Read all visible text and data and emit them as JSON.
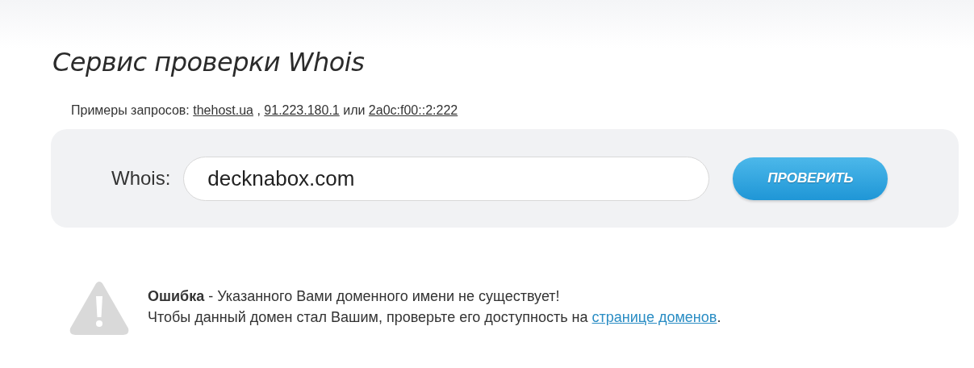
{
  "title": "Сервис проверки Whois",
  "examples": {
    "label": "Примеры запросов:",
    "links": [
      "thehost.ua",
      "91.223.180.1",
      "2a0c:f00::2:222"
    ],
    "separator": ",",
    "last_separator": "или"
  },
  "search": {
    "label": "Whois:",
    "value": "decknabox.com",
    "button": "ПРОВЕРИТЬ"
  },
  "error": {
    "message": "**Ошибка** - Указанного Вами доменного имени не существует!",
    "hint": "Чтобы данный домен стал Вашим, проверьте его доступность на",
    "link": "странице доменов",
    "suffix": "."
  }
}
